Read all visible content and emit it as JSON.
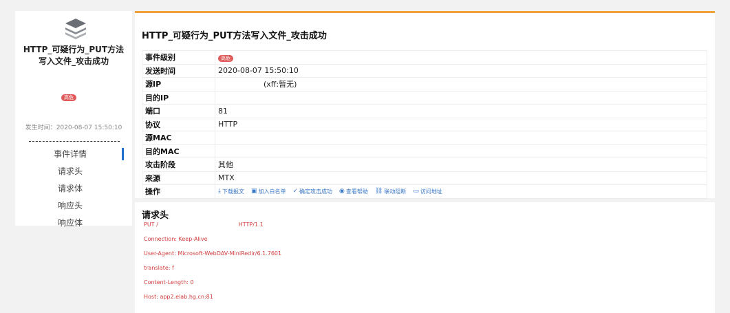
{
  "sidebar": {
    "title": "HTTP_可疑行为_PUT方法写入文件_攻击成功",
    "level_badge": "高危",
    "time_label": "发生时间：2020-08-07 15:50:10",
    "nav": [
      {
        "label": "事件详情",
        "active": true
      },
      {
        "label": "请求头"
      },
      {
        "label": "请求体"
      },
      {
        "label": "响应头"
      },
      {
        "label": "响应体"
      }
    ]
  },
  "detail": {
    "title": "HTTP_可疑行为_PUT方法写入文件_攻击成功",
    "rows": {
      "level": {
        "key": "事件级别",
        "value": "高危"
      },
      "send_time": {
        "key": "发送时间",
        "value": "2020-08-07 15:50:10"
      },
      "src_ip": {
        "key": "源IP",
        "value": "(xff:暂无)"
      },
      "dst_ip": {
        "key": "目的IP",
        "value": ""
      },
      "port": {
        "key": "端口",
        "value": "81"
      },
      "protocol": {
        "key": "协议",
        "value": "HTTP"
      },
      "src_mac": {
        "key": "源MAC",
        "value": ""
      },
      "dst_mac": {
        "key": "目的MAC",
        "value": ""
      },
      "stage": {
        "key": "攻击阶段",
        "value": "其他"
      },
      "source": {
        "key": "来源",
        "value": "MTX"
      },
      "ops": {
        "key": "操作"
      }
    },
    "actions": {
      "download": "下载报文",
      "whitelist": "加入白名单",
      "confirm": "确定攻击成功",
      "help": "查看帮助",
      "block": "联动阻断",
      "visit": "访问地址"
    }
  },
  "request_header": {
    "title": "请求头",
    "lines": [
      "PUT /                                              HTTP/1.1",
      "Connection: Keep-Alive",
      "User-Agent: Microsoft-WebDAV-MiniRedir/6.1.7601",
      "translate: f",
      "Content-Length: 0",
      "Host: app2.elab.hg.cn:81"
    ]
  },
  "colors": {
    "accent": "#f0a33a",
    "badge": "#e05a5a",
    "link": "#3a78c8",
    "request_text": "#d23c3c"
  }
}
